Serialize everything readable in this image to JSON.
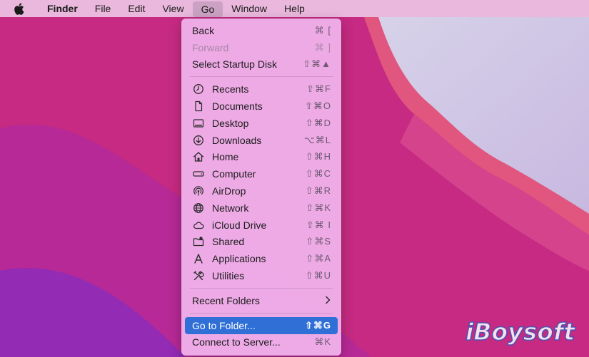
{
  "menubar": {
    "app": "Finder",
    "items": [
      "File",
      "Edit",
      "View",
      "Go",
      "Window",
      "Help"
    ],
    "active": "Go"
  },
  "menu": {
    "back": {
      "label": "Back",
      "shortcut": "⌘ ["
    },
    "forward": {
      "label": "Forward",
      "shortcut": "⌘ ]"
    },
    "startup": {
      "label": "Select Startup Disk",
      "shortcut": "⇧⌘▲"
    },
    "locations": [
      {
        "label": "Recents",
        "shortcut": "⇧⌘F",
        "icon": "clock-icon"
      },
      {
        "label": "Documents",
        "shortcut": "⇧⌘O",
        "icon": "document-icon"
      },
      {
        "label": "Desktop",
        "shortcut": "⇧⌘D",
        "icon": "desktop-icon"
      },
      {
        "label": "Downloads",
        "shortcut": "⌥⌘L",
        "icon": "download-icon"
      },
      {
        "label": "Home",
        "shortcut": "⇧⌘H",
        "icon": "home-icon"
      },
      {
        "label": "Computer",
        "shortcut": "⇧⌘C",
        "icon": "computer-icon"
      },
      {
        "label": "AirDrop",
        "shortcut": "⇧⌘R",
        "icon": "airdrop-icon"
      },
      {
        "label": "Network",
        "shortcut": "⇧⌘K",
        "icon": "network-icon"
      },
      {
        "label": "iCloud Drive",
        "shortcut": "⇧⌘ I",
        "icon": "cloud-icon"
      },
      {
        "label": "Shared",
        "shortcut": "⇧⌘S",
        "icon": "shared-folder-icon"
      },
      {
        "label": "Applications",
        "shortcut": "⇧⌘A",
        "icon": "applications-icon"
      },
      {
        "label": "Utilities",
        "shortcut": "⇧⌘U",
        "icon": "utilities-icon"
      }
    ],
    "recent_folders": {
      "label": "Recent Folders"
    },
    "go_to_folder": {
      "label": "Go to Folder...",
      "shortcut": "⇧⌘G"
    },
    "connect_server": {
      "label": "Connect to Server...",
      "shortcut": "⌘K"
    }
  },
  "colors": {
    "highlight": "#2f6fd6",
    "menu_bg": "#f0b2eb"
  },
  "watermark": "iBoysoft"
}
